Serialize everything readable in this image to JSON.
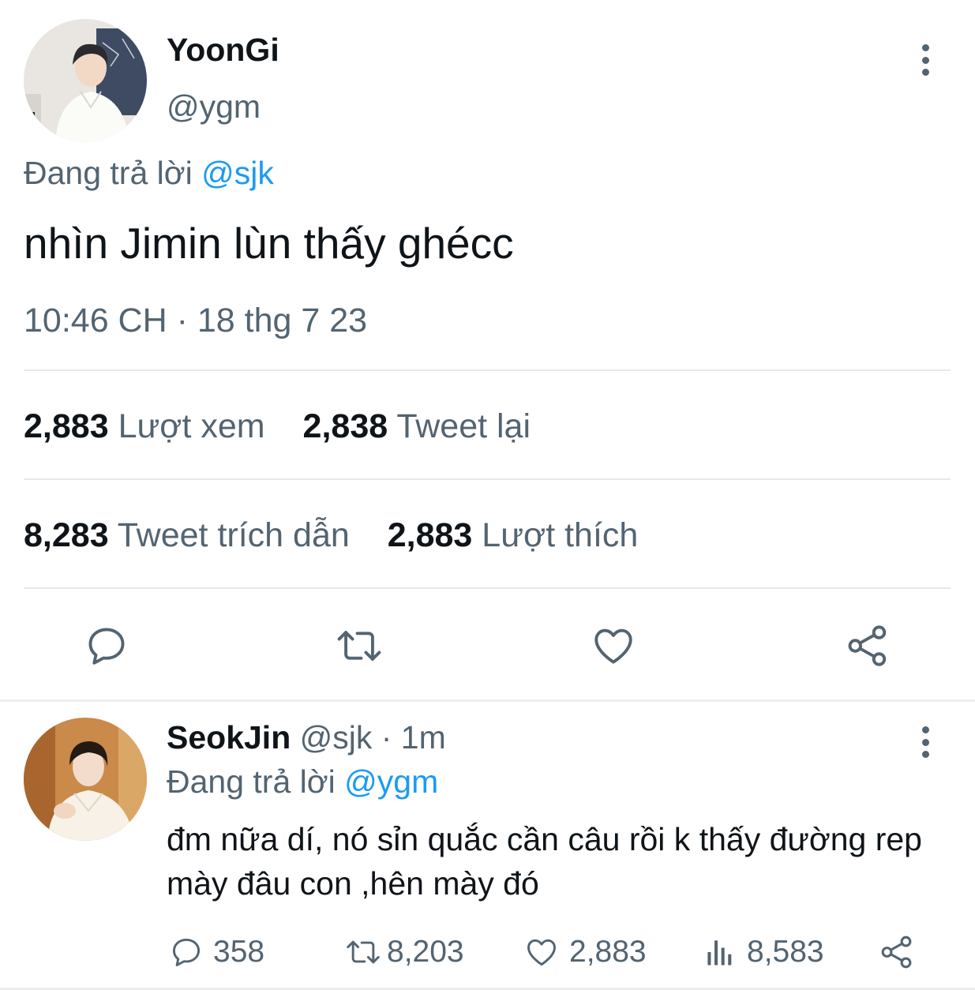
{
  "main_tweet": {
    "display_name": "YoonGi",
    "handle": "@ygm",
    "replying_prefix": "Đang trả lời ",
    "replying_to": "@sjk",
    "text": "nhìn Jimin lùn thấy ghécc",
    "timestamp": "10:46 CH · 18 thg 7 23",
    "stats": {
      "views_count": "2,883",
      "views_label": "Lượt xem",
      "retweets_count": "2,838",
      "retweets_label": "Tweet lại",
      "quotes_count": "8,283",
      "quotes_label": "Tweet trích dẫn",
      "likes_count": "2,883",
      "likes_label": "Lượt thích"
    },
    "actions": [
      "reply-icon",
      "retweet-icon",
      "like-icon",
      "share-icon"
    ]
  },
  "reply_tweet": {
    "display_name": "SeokJin",
    "meta": " @sjk · 1m",
    "replying_prefix": "Đang trả lời ",
    "replying_to": "@ygm",
    "text": "đm nữa dí, nó sỉn quắc cần câu rồi k thấy đường rep mày đâu con ,hên mày đó",
    "actions": {
      "replies": "358",
      "retweets": "8,203",
      "likes": "2,883",
      "views": "8,583"
    }
  },
  "colors": {
    "text_primary": "#0f1419",
    "text_secondary": "#536471",
    "accent": "#1d9bf0",
    "divider": "#e6e8ea"
  }
}
